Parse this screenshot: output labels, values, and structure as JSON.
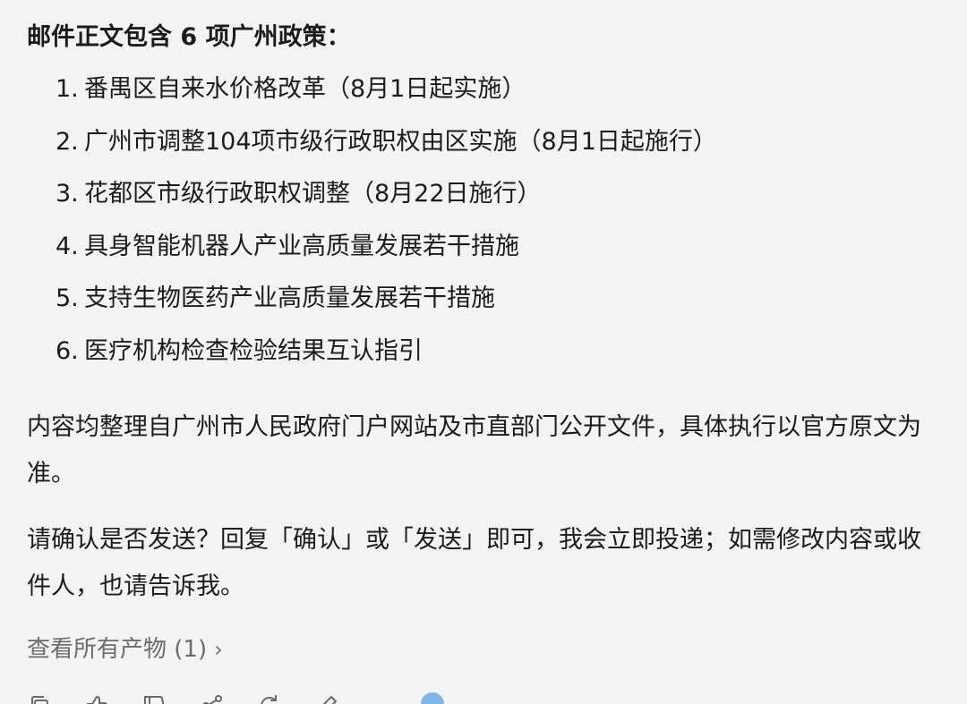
{
  "message": {
    "intro": "邮件正文包含 6 项广州政策：",
    "policies": [
      {
        "num": "1.",
        "text": "番禺区自来水价格改革（8月1日起实施）"
      },
      {
        "num": "2.",
        "text": "广州市调整104项市级行政职权由区实施（8月1日起施行）"
      },
      {
        "num": "3.",
        "text": "花都区市级行政职权调整（8月22日施行）"
      },
      {
        "num": "4.",
        "text": "具身智能机器人产业高质量发展若干措施"
      },
      {
        "num": "5.",
        "text": "支持生物医药产业高质量发展若干措施"
      },
      {
        "num": "6.",
        "text": "医疗机构检查检验结果互认指引"
      }
    ],
    "source_note": "内容均整理自广州市人民政府门户网站及市直部门公开文件，具体执行以官方原文为准。",
    "confirm_prompt": "请确认是否发送？回复「确认」或「发送」即可，我会立即投递；如需修改内容或收件人，也请告诉我。"
  },
  "artifacts_link": {
    "label": "查看所有产物 (1)",
    "chevron": "›"
  },
  "toolbar": {
    "icons": [
      "copy-icon",
      "thumbs-up-icon",
      "thumbs-down-icon",
      "share-icon",
      "regenerate-icon",
      "edit-icon"
    ]
  },
  "colors": {
    "background": "#f3f3f3",
    "text": "#1c1c1c",
    "muted": "#6b6b6b",
    "model_dot": "#7fb6e6"
  }
}
